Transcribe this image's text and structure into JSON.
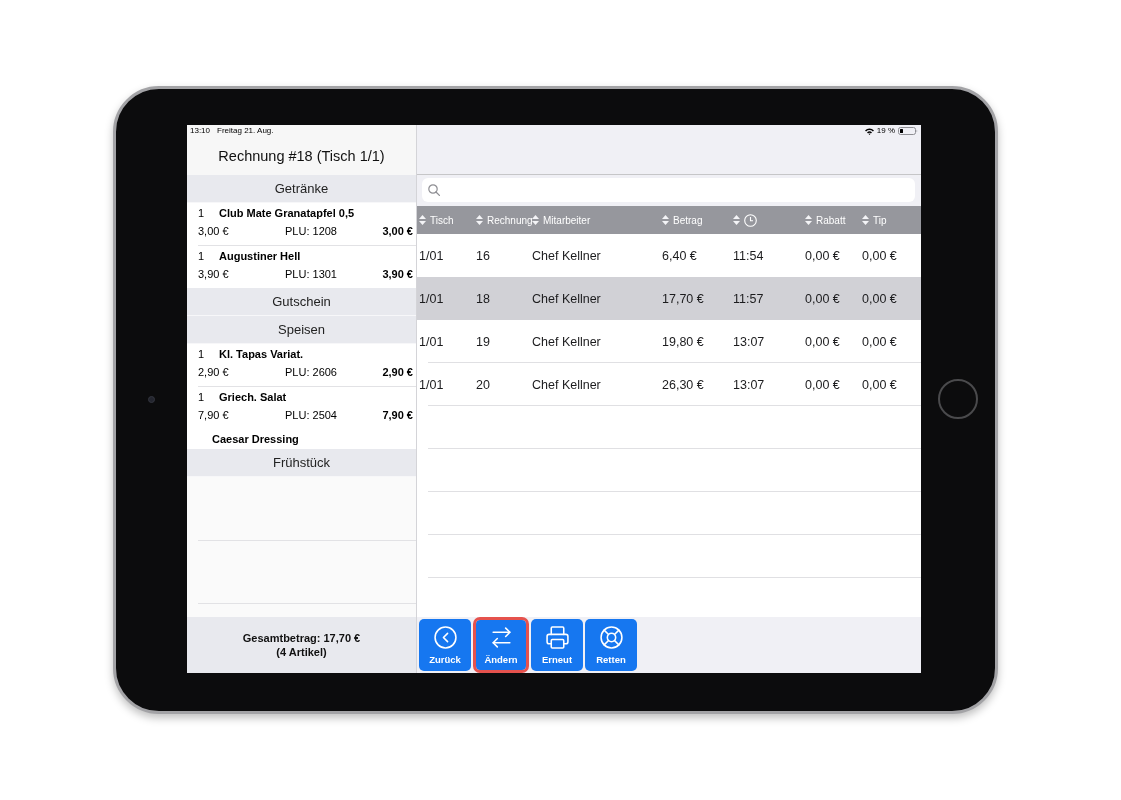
{
  "status_bar": {
    "time": "13:10",
    "date": "Freitag 21. Aug.",
    "battery": "19 %"
  },
  "order": {
    "title": "Rechnung #18 (Tisch 1/1)",
    "sections": [
      {
        "title": "Getränke",
        "items": [
          {
            "quantity": "1",
            "name": "Club Mate Granatapfel 0,5",
            "unit_price": "3,00 €",
            "plu": "PLU: 1208",
            "total": "3,00 €"
          },
          {
            "quantity": "1",
            "name": "Augustiner Hell",
            "unit_price": "3,90 €",
            "plu": "PLU: 1301",
            "total": "3,90 €"
          }
        ]
      },
      {
        "title": "Gutschein"
      },
      {
        "title": "Speisen",
        "items": [
          {
            "quantity": "1",
            "name": "Kl. Tapas Variat.",
            "unit_price": "2,90 €",
            "plu": "PLU: 2606",
            "total": "2,90 €"
          },
          {
            "quantity": "1",
            "name": "Griech. Salat",
            "unit_price": "7,90 €",
            "plu": "PLU: 2504",
            "total": "7,90 €",
            "modifiers": [
              "Caesar Dressing"
            ]
          }
        ]
      },
      {
        "title": "Frühstück"
      }
    ],
    "footer": {
      "total": "Gesamtbetrag: 17,70 €",
      "article_count": "(4 Artikel)"
    }
  },
  "table": {
    "columns": [
      {
        "kind": "text",
        "label": "Tisch"
      },
      {
        "kind": "text",
        "label": "Rechnung"
      },
      {
        "kind": "text",
        "label": "Mitarbeiter"
      },
      {
        "kind": "text",
        "label": "Betrag"
      },
      {
        "kind": "icon"
      },
      {
        "kind": "text",
        "label": "Rabatt"
      },
      {
        "kind": "text",
        "label": "Tip"
      }
    ],
    "rows": [
      {
        "selected": false,
        "cells": [
          "1/01",
          "16",
          "Chef Kellner",
          "6,40 €",
          "11:54",
          "0,00 €",
          "0,00 €"
        ]
      },
      {
        "selected": true,
        "cells": [
          "1/01",
          "18",
          "Chef Kellner",
          "17,70 €",
          "11:57",
          "0,00 €",
          "0,00 €"
        ]
      },
      {
        "selected": false,
        "cells": [
          "1/01",
          "19",
          "Chef Kellner",
          "19,80 €",
          "13:07",
          "0,00 €",
          "0,00 €"
        ]
      },
      {
        "selected": false,
        "cells": [
          "1/01",
          "20",
          "Chef Kellner",
          "26,30 €",
          "13:07",
          "0,00 €",
          "0,00 €"
        ]
      }
    ]
  },
  "toolbar": [
    {
      "label": "Zurück",
      "selected": false
    },
    {
      "label": "Ändern",
      "selected": true
    },
    {
      "label": "Erneut",
      "selected": false
    },
    {
      "label": "Retten",
      "selected": false
    }
  ]
}
